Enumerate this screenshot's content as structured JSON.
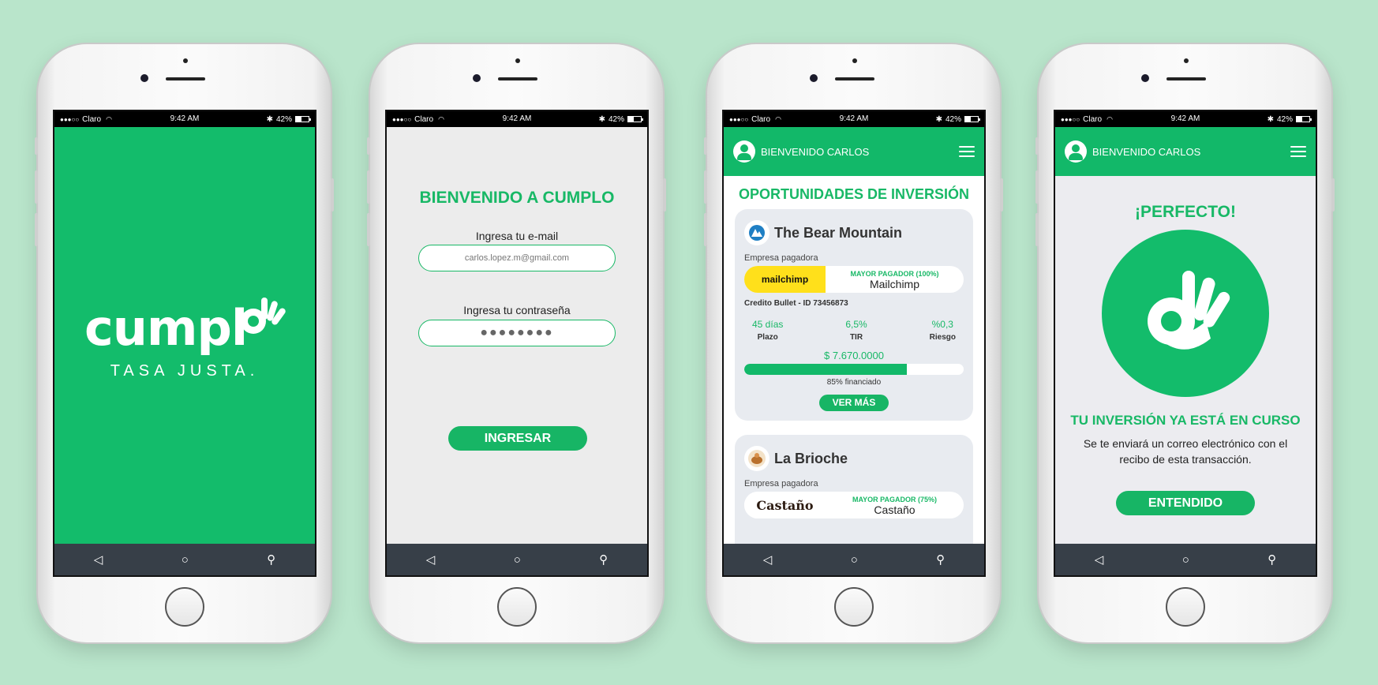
{
  "statusbar": {
    "signal": "●●●○○",
    "carrier": "Claro",
    "time": "9:42 AM",
    "battery": "42%"
  },
  "nav_icons": [
    "back-icon",
    "home-icon",
    "search-icon"
  ],
  "colors": {
    "brand_green": "#13bc6b",
    "nav_dark": "#373f48",
    "background": "#b9e5cb"
  },
  "splash": {
    "logo": "cumpl",
    "tagline": "TASA JUSTA."
  },
  "login": {
    "title": "BIENVENIDO A CUMPLO",
    "email_label": "Ingresa tu e-mail",
    "email_value": "carlos.lopez.m@gmail.com",
    "password_label": "Ingresa tu contraseña",
    "password_value": "●●●●●●●●",
    "submit_label": "INGRESAR"
  },
  "header": {
    "welcome": "BIENVENIDO CARLOS"
  },
  "feed": {
    "title": "OPORTUNIDADES DE INVERSIÓN",
    "cards": [
      {
        "company": "The Bear Mountain",
        "payer_label": "Empresa pagadora",
        "payer_logo": "mailchimp",
        "payer_badge": "MAYOR PAGADOR (100%)",
        "payer_name": "Mailchimp",
        "credit": "Credito Bullet - ID 73456873",
        "stats": [
          {
            "value": "45 días",
            "label": "Plazo"
          },
          {
            "value": "6,5%",
            "label": "TIR"
          },
          {
            "value": "%0,3",
            "label": "Riesgo"
          }
        ],
        "amount": "$ 7.670.0000",
        "funded_fraction": 0.74,
        "funded_label": "85% financiado",
        "cta": "VER MÁS"
      },
      {
        "company": "La Brioche",
        "payer_label": "Empresa pagadora",
        "payer_logo": "Castaño",
        "payer_badge": "MAYOR PAGADOR (75%)",
        "payer_name": "Castaño"
      }
    ]
  },
  "confirmation": {
    "title": "¡PERFECTO!",
    "status_title": "TU INVERSIÓN YA ESTÁ EN CURSO",
    "message": "Se te enviará un correo electrónico con el recibo de esta transacción.",
    "button": "ENTENDIDO"
  }
}
